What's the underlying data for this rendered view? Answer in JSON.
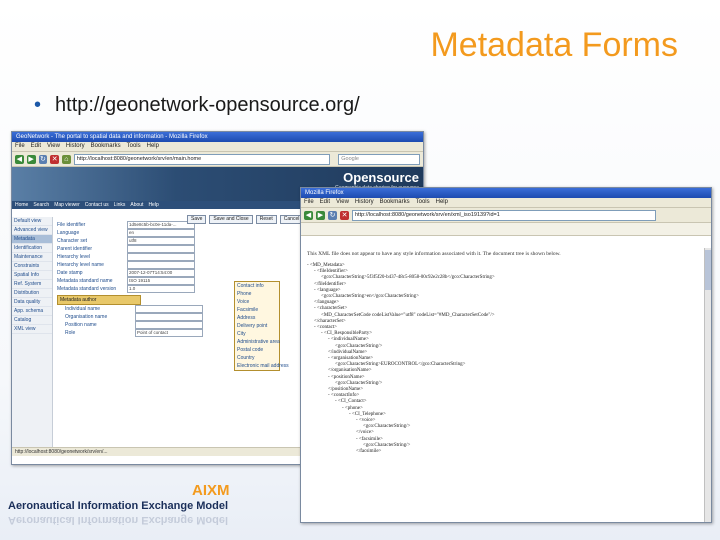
{
  "slide": {
    "title": "Metadata Forms",
    "bullet": "http://geonetwork-opensource.org/"
  },
  "window1": {
    "title": "GeoNetwork - The portal to spatial data and information - Mozilla Firefox",
    "menu": [
      "File",
      "Edit",
      "View",
      "History",
      "Bookmarks",
      "Tools",
      "Help"
    ],
    "url": "http://localhost:8080/geonetwork/srv/en/main.home",
    "search_placeholder": "Google",
    "brand": "Opensource",
    "tagline": "Geographic data sharing for everyone",
    "nav": [
      "Home",
      "Search",
      "Map viewer",
      "Contact us",
      "Links",
      "About",
      "Help"
    ],
    "left_nav": [
      "Default view",
      "Advanced view",
      "Metadata",
      "Identification",
      "Maintenance",
      "Constraints",
      "Spatial Info",
      "Ref. System",
      "Distribution",
      "Data quality",
      "App. schema",
      "Catalog",
      "XML view"
    ],
    "left_nav_selected": 2,
    "buttons": [
      "Save",
      "Save and Close",
      "Reset",
      "Cancel"
    ],
    "fields": [
      {
        "label": "File identifier",
        "value": "1d5e8c5b-bc0e-11da-..."
      },
      {
        "label": "Language",
        "value": "en"
      },
      {
        "label": "Character set",
        "value": "utf8"
      },
      {
        "label": "Parent identifier",
        "value": ""
      },
      {
        "label": "Hierarchy level",
        "value": ""
      },
      {
        "label": "Hierarchy level name",
        "value": ""
      },
      {
        "label": "Date stamp",
        "value": "2007-12-07T14:54:00"
      },
      {
        "label": "Metadata standard name",
        "value": "ISO 19115"
      },
      {
        "label": "Metadata standard version",
        "value": "1.0"
      }
    ],
    "section": "Metadata author",
    "contact_fields": [
      "Individual name",
      "Organisation name",
      "Position name",
      "Role"
    ],
    "role_value": "Point of contact",
    "contact_info": [
      "Contact info",
      "Phone",
      "Voice",
      "Facsimile",
      "Address",
      "Delivery point",
      "City",
      "Administrative area",
      "Postal code",
      "Country",
      "Electronic mail address"
    ],
    "status": "http://localhost:8080/geonetwork/srv/en/..."
  },
  "window2": {
    "title": "Mozilla Firefox",
    "menu": [
      "File",
      "Edit",
      "View",
      "History",
      "Bookmarks",
      "Tools",
      "Help"
    ],
    "url": "http://localhost:8080/geonetwork/srv/en/xml_iso19139?id=1",
    "message": "This XML file does not appear to have any style information associated with it. The document tree is shown below.",
    "xml": [
      {
        "indent": 0,
        "text": "- <MD_Metadata>"
      },
      {
        "indent": 1,
        "text": "- <fileIdentifier>"
      },
      {
        "indent": 2,
        "text": "<gco:CharacterString>5f3f5f20-b437-48c5-8058-00c92e2c28b</gco:CharacterString>"
      },
      {
        "indent": 1,
        "text": "</fileIdentifier>"
      },
      {
        "indent": 1,
        "text": "- <language>"
      },
      {
        "indent": 2,
        "text": "<gco:CharacterString>en</gco:CharacterString>"
      },
      {
        "indent": 1,
        "text": "</language>"
      },
      {
        "indent": 1,
        "text": "- <characterSet>"
      },
      {
        "indent": 2,
        "text": "<MD_CharacterSetCode codeListValue=\"utf8\" codeList=\"#MD_CharacterSetCode\"/>"
      },
      {
        "indent": 1,
        "text": "</characterSet>"
      },
      {
        "indent": 1,
        "text": "- <contact>"
      },
      {
        "indent": 2,
        "text": "- <CI_ResponsibleParty>"
      },
      {
        "indent": 3,
        "text": "- <individualName>"
      },
      {
        "indent": 4,
        "text": "<gco:CharacterString/>"
      },
      {
        "indent": 3,
        "text": "</individualName>"
      },
      {
        "indent": 3,
        "text": "- <organisationName>"
      },
      {
        "indent": 4,
        "text": "<gco:CharacterString>EUROCONTROL</gco:CharacterString>"
      },
      {
        "indent": 3,
        "text": "</organisationName>"
      },
      {
        "indent": 3,
        "text": "- <positionName>"
      },
      {
        "indent": 4,
        "text": "<gco:CharacterString/>"
      },
      {
        "indent": 3,
        "text": "</positionName>"
      },
      {
        "indent": 3,
        "text": "- <contactInfo>"
      },
      {
        "indent": 4,
        "text": "- <CI_Contact>"
      },
      {
        "indent": 5,
        "text": "- <phone>"
      },
      {
        "indent": 6,
        "text": "- <CI_Telephone>"
      },
      {
        "indent": 7,
        "text": "- <voice>"
      },
      {
        "indent": 8,
        "text": "<gco:CharacterString/>"
      },
      {
        "indent": 7,
        "text": "</voice>"
      },
      {
        "indent": 7,
        "text": "- <facsimile>"
      },
      {
        "indent": 8,
        "text": "<gco:CharacterString/>"
      },
      {
        "indent": 7,
        "text": "</facsimile>"
      }
    ]
  },
  "footer": {
    "logo": "AIXM",
    "subtitle": "Aeronautical Information Exchange Model"
  },
  "colors": {
    "title_orange": "#f39a1e",
    "bullet_blue": "#1b58a8",
    "footer_navy": "#1b2f5a"
  }
}
